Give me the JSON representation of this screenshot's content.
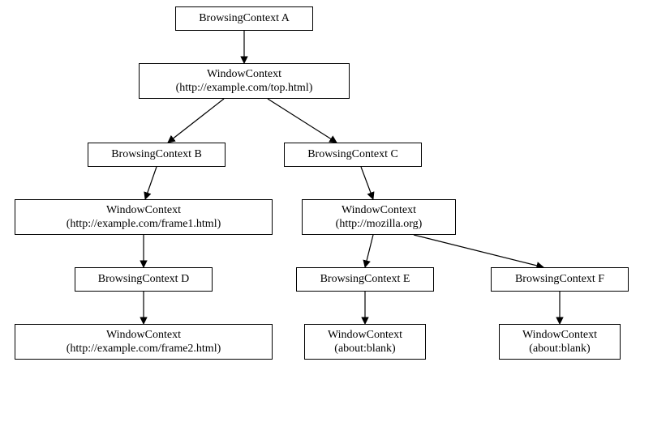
{
  "nodes": {
    "bcA": {
      "label": "BrowsingContext A"
    },
    "wcA": {
      "label": "WindowContext\n(http://example.com/top.html)"
    },
    "bcB": {
      "label": "BrowsingContext B"
    },
    "bcC": {
      "label": "BrowsingContext C"
    },
    "wcB": {
      "label": "WindowContext\n(http://example.com/frame1.html)"
    },
    "wcC": {
      "label": "WindowContext\n(http://mozilla.org)"
    },
    "bcD": {
      "label": "BrowsingContext D"
    },
    "bcE": {
      "label": "BrowsingContext E"
    },
    "bcF": {
      "label": "BrowsingContext F"
    },
    "wcD": {
      "label": "WindowContext\n(http://example.com/frame2.html)"
    },
    "wcE": {
      "label": "WindowContext\n(about:blank)"
    },
    "wcF": {
      "label": "WindowContext\n(about:blank)"
    }
  },
  "edges": [
    {
      "from": "bcA",
      "to": "wcA"
    },
    {
      "from": "wcA",
      "to": "bcB"
    },
    {
      "from": "wcA",
      "to": "bcC"
    },
    {
      "from": "bcB",
      "to": "wcB"
    },
    {
      "from": "bcC",
      "to": "wcC"
    },
    {
      "from": "wcB",
      "to": "bcD"
    },
    {
      "from": "wcC",
      "to": "bcE"
    },
    {
      "from": "wcC",
      "to": "bcF"
    },
    {
      "from": "bcD",
      "to": "wcD"
    },
    {
      "from": "bcE",
      "to": "wcE"
    },
    {
      "from": "bcF",
      "to": "wcF"
    }
  ]
}
